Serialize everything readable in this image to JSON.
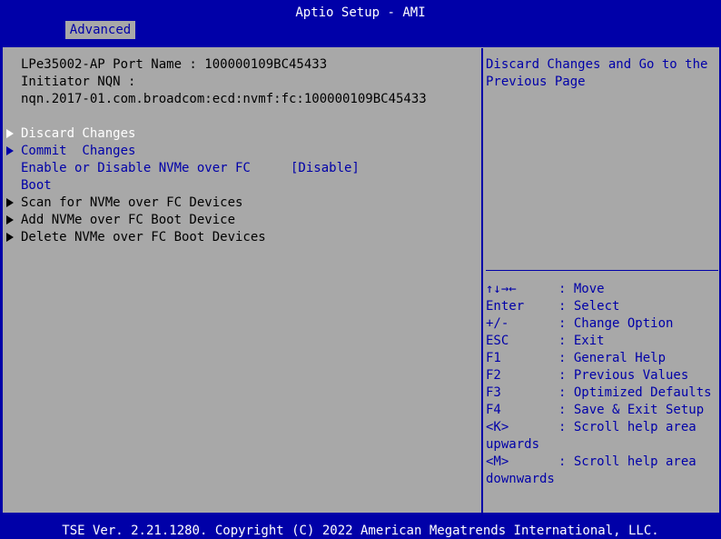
{
  "header": {
    "title": "Aptio Setup - AMI",
    "tab_label": "Advanced"
  },
  "info": {
    "port_name": "LPe35002-AP Port Name : 100000109BC45433",
    "initiator_label": "Initiator NQN :",
    "initiator_value": "nqn.2017-01.com.broadcom:ecd:nvmf:fc:100000109BC45433"
  },
  "menu": {
    "discard": "Discard Changes",
    "commit": "Commit  Changes",
    "enable_line1": "Enable or Disable NVMe over FC",
    "enable_line2": "Boot",
    "enable_value": "[Disable]",
    "scan": "Scan for NVMe over FC Devices",
    "add": "Add NVMe over FC Boot Device",
    "delete": "Delete NVMe over FC Boot Devices"
  },
  "help": {
    "line1": "Discard Changes and Go to the",
    "line2": "Previous Page"
  },
  "keys": [
    {
      "key": "↑↓→←",
      "desc": ": Move"
    },
    {
      "key": "Enter",
      "desc": ": Select"
    },
    {
      "key": "+/-",
      "desc": ": Change Option"
    },
    {
      "key": "ESC",
      "desc": ": Exit"
    },
    {
      "key": "F1",
      "desc": ": General Help"
    },
    {
      "key": "F2",
      "desc": ": Previous Values"
    },
    {
      "key": "F3",
      "desc": ": Optimized Defaults"
    },
    {
      "key": "F4",
      "desc": ": Save & Exit Setup"
    },
    {
      "key": "<K>",
      "desc": ": Scroll help area",
      "cont": "upwards"
    },
    {
      "key": "<M>",
      "desc": ": Scroll help area",
      "cont": "downwards"
    }
  ],
  "footer": {
    "text": "TSE Ver. 2.21.1280. Copyright (C) 2022 American Megatrends International, LLC."
  },
  "colors": {
    "bios_blue": "#0000a8",
    "panel_gray": "#a8a8a8",
    "highlight": "#ffffff",
    "text": "#000000"
  }
}
